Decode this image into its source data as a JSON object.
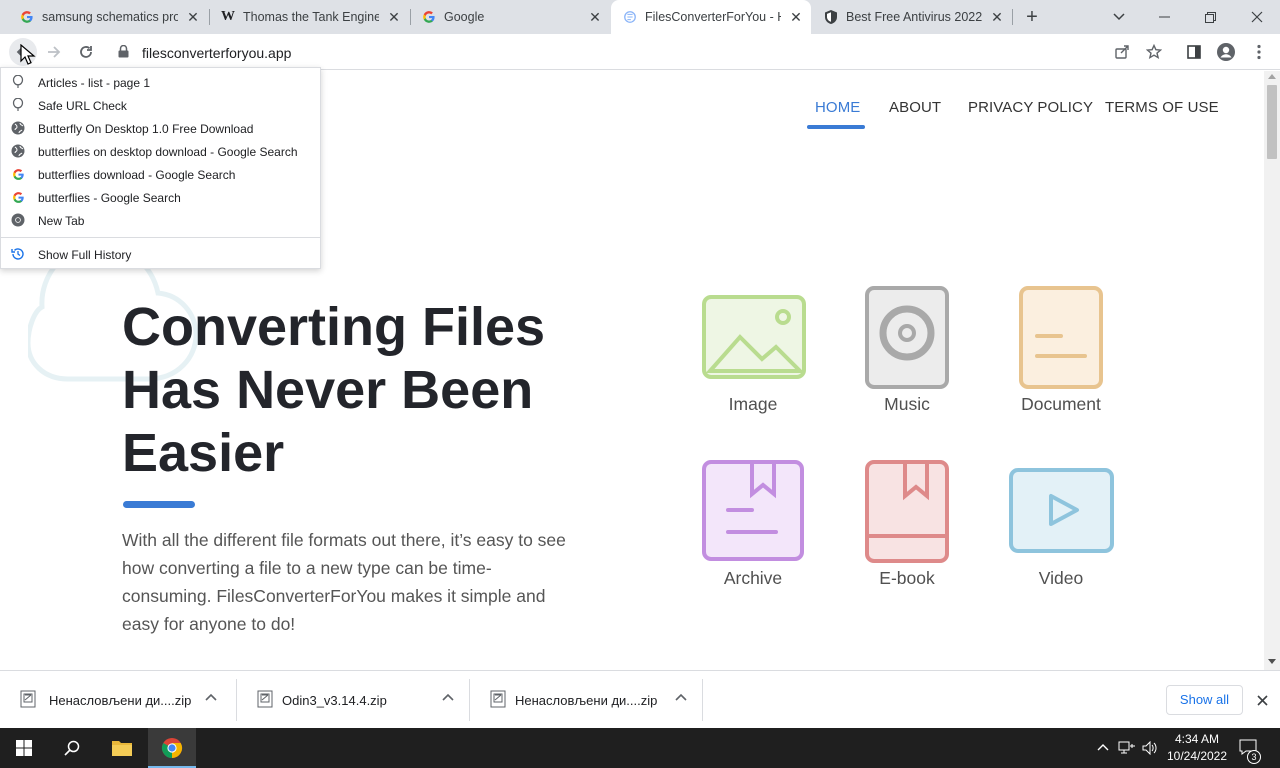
{
  "tabs": [
    {
      "title": "samsung schematics prog",
      "favicon": "google-g-icon",
      "active": false
    },
    {
      "title": "Thomas the Tank Engine -",
      "favicon": "wikipedia-w-icon",
      "active": false
    },
    {
      "title": "Google",
      "favicon": "google-g-icon",
      "active": false
    },
    {
      "title": "FilesConverterForYou - H",
      "favicon": "site-globe-icon",
      "active": true
    },
    {
      "title": "Best Free Antivirus 2022 -",
      "favicon": "shield-icon",
      "active": false
    }
  ],
  "toolbar": {
    "url": "filesconverterforyou.app"
  },
  "history_menu": {
    "items": [
      {
        "label": "Articles - list - page 1",
        "icon": "balloon-icon"
      },
      {
        "label": "Safe URL Check",
        "icon": "balloon-icon"
      },
      {
        "label": "Butterfly On Desktop 1.0 Free Download",
        "icon": "globe-icon"
      },
      {
        "label": "butterflies on desktop download - Google Search",
        "icon": "globe-icon"
      },
      {
        "label": "butterflies download - Google Search",
        "icon": "google-g-icon"
      },
      {
        "label": "butterflies - Google Search",
        "icon": "google-g-icon"
      },
      {
        "label": "New Tab",
        "icon": "chrome-icon"
      }
    ],
    "show_full_history": "Show Full History"
  },
  "site": {
    "nav": [
      "HOME",
      "ABOUT",
      "PRIVACY POLICY",
      "TERMS OF USE"
    ],
    "hero_title": "Converting Files Has Never Been Easier",
    "hero_text": "With all the different file formats out there, it’s easy to see how converting a file to a new type can be time-consuming. FilesConverterForYou makes it simple and easy for anyone to do!",
    "file_types": [
      "Image",
      "Music",
      "Document",
      "Archive",
      "E-book",
      "Video"
    ],
    "colors": {
      "accent": "#3a7bd5",
      "image": "#b9dc8f",
      "music": "#a9a9a9",
      "document": "#e8c48f",
      "archive": "#c28ee0",
      "ebook": "#de8a8a",
      "video": "#8ec4dd"
    }
  },
  "downloads": {
    "files": [
      "Ненасловљени ди....zip",
      "Odin3_v3.14.4.zip",
      "Ненасловљени ди....zip"
    ],
    "show_all": "Show all"
  },
  "taskbar": {
    "time": "4:34 AM",
    "date": "10/24/2022",
    "notifications": "3"
  }
}
